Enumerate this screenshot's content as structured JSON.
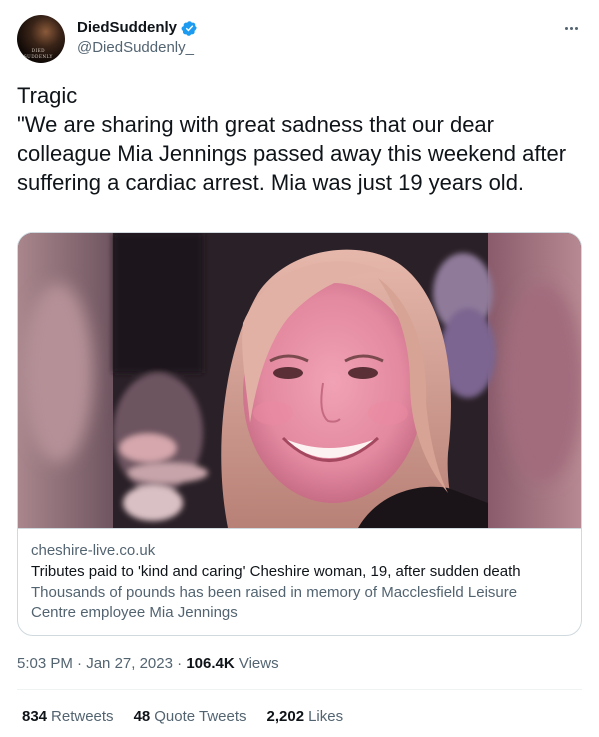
{
  "author": {
    "display_name": "DiedSuddenly",
    "handle": "@DiedSuddenly_",
    "avatar_text": "DIED SUDDENLY",
    "verified_icon": "verified-badge-icon",
    "verified_color": "#1d9bf0"
  },
  "more_icon": "more-options-icon",
  "tweet": {
    "text": "Tragic\n\"We are sharing with great sadness that our dear colleague Mia Jennings passed away this weekend after suffering a cardiac arrest. Mia was just 19 years old."
  },
  "card": {
    "domain": "cheshire-live.co.uk",
    "title": "Tributes paid to 'kind and caring' Cheshire woman, 19, after sudden death",
    "description": "Thousands of pounds has been raised in memory of Macclesfield Leisure Centre employee Mia Jennings"
  },
  "meta": {
    "time": "5:03 PM",
    "date": "Jan 27, 2023",
    "views_count": "106.4K",
    "views_label": "Views"
  },
  "stats": {
    "retweets_count": "834",
    "retweets_label": "Retweets",
    "quotes_count": "48",
    "quotes_label": "Quote Tweets",
    "likes_count": "2,202",
    "likes_label": "Likes"
  },
  "colors": {
    "text_primary": "#0f1419",
    "text_secondary": "#536471",
    "border": "#cfd9de"
  }
}
